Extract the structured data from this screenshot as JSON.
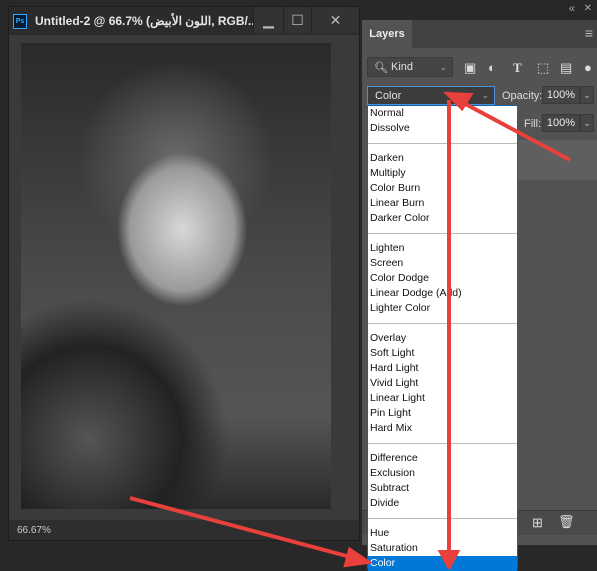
{
  "document": {
    "title": "Untitled-2 @ 66.7% (اللون الأبيض, RGB/...",
    "app_badge": "Ps",
    "zoom": "66.67%",
    "minimize": "▁",
    "maximize": "☐",
    "close": "✕"
  },
  "panel": {
    "collapse": "«",
    "close": "✕",
    "tab": "Layers",
    "menu_icon": "≡",
    "filter_kind": "Kind",
    "blend_mode": "Color",
    "opacity_label": "Opacity:",
    "opacity": "100%",
    "fill_label": "Fill:",
    "fill": "100%"
  },
  "blend_menu": {
    "groups": [
      [
        "Normal",
        "Dissolve"
      ],
      [
        "Darken",
        "Multiply",
        "Color Burn",
        "Linear Burn",
        "Darker Color"
      ],
      [
        "Lighten",
        "Screen",
        "Color Dodge",
        "Linear Dodge (Add)",
        "Lighter Color"
      ],
      [
        "Overlay",
        "Soft Light",
        "Hard Light",
        "Vivid Light",
        "Linear Light",
        "Pin Light",
        "Hard Mix"
      ],
      [
        "Difference",
        "Exclusion",
        "Subtract",
        "Divide"
      ],
      [
        "Hue",
        "Saturation",
        "Color"
      ]
    ],
    "selected": "Color"
  },
  "colors": {
    "accent": "#0078d7",
    "arrow": "#e8403a"
  }
}
